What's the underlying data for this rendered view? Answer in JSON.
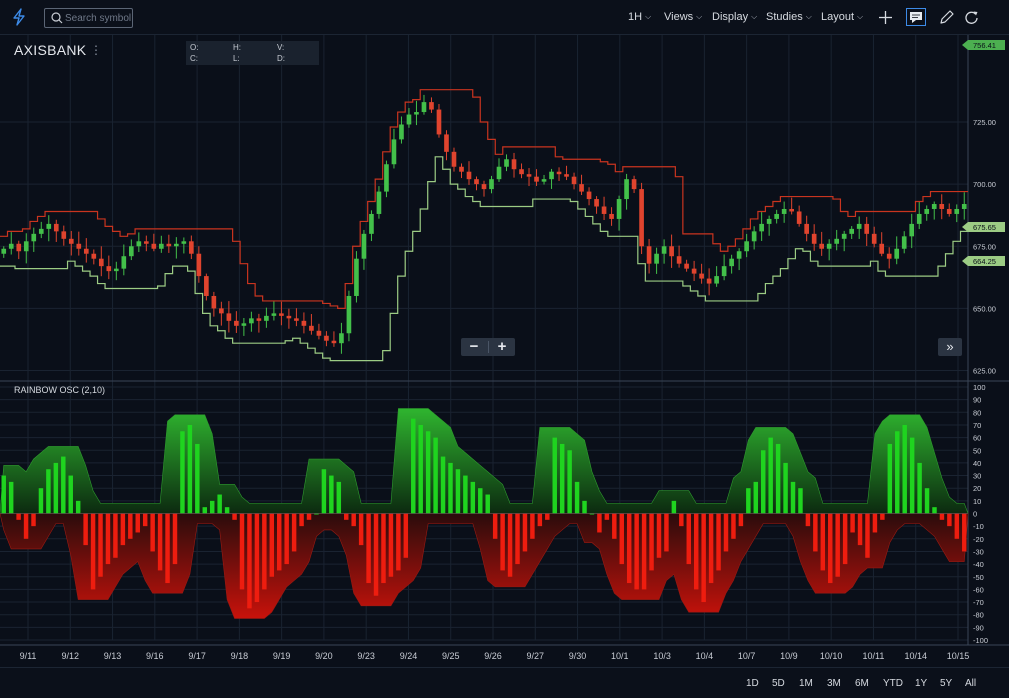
{
  "toolbar": {
    "search_placeholder": "Search symbol",
    "interval": "1H",
    "menus": [
      "Views",
      "Display",
      "Studies",
      "Layout"
    ]
  },
  "symbol": {
    "name": "AXISBANK"
  },
  "ohlc": {
    "o": "O:",
    "h": "H:",
    "v": "V:",
    "c": "C:",
    "l": "L:",
    "d": "D:"
  },
  "indicator": {
    "label": "RAINBOW OSC (2,10)"
  },
  "price_axis": {
    "ticks": [
      "725.00",
      "700.00",
      "675.00",
      "650.00",
      "625.00"
    ],
    "badges": [
      {
        "text": "756.41",
        "color": "#4caf50"
      },
      {
        "text": "675.65",
        "color": "#9ccc84"
      },
      {
        "text": "664.25",
        "color": "#9ccc84"
      }
    ]
  },
  "osc_axis": {
    "ticks": [
      "100",
      "90",
      "80",
      "70",
      "60",
      "50",
      "40",
      "30",
      "20",
      "10",
      "0",
      "-10",
      "-20",
      "-30",
      "-40",
      "-50",
      "-60",
      "-70",
      "-80",
      "-90",
      "-100"
    ]
  },
  "x_axis": {
    "labels": [
      "9/11",
      "9/12",
      "9/13",
      "9/16",
      "9/17",
      "9/18",
      "9/19",
      "9/20",
      "9/23",
      "9/24",
      "9/25",
      "9/26",
      "9/27",
      "9/30",
      "10/1",
      "10/3",
      "10/4",
      "10/7",
      "10/9",
      "10/10",
      "10/11",
      "10/14",
      "10/15"
    ]
  },
  "ranges": [
    "1D",
    "5D",
    "1M",
    "3M",
    "6M",
    "YTD",
    "1Y",
    "5Y",
    "All"
  ],
  "zoom": {
    "minus": "−",
    "plus": "+"
  },
  "ff": "»",
  "colors": {
    "up": "#43c04a",
    "down": "#e0442e",
    "upper_band": "#c9341f",
    "lower_band": "#9ccc84",
    "osc_up": "#1fd41f",
    "osc_down": "#ee1d0f",
    "background": "#0a0f19",
    "grid": "#1a2331"
  },
  "chart_data": {
    "type": "candlestick",
    "price_ylim": [
      622,
      760
    ],
    "close_series": [
      674,
      676,
      673,
      677,
      680,
      682,
      684,
      681,
      678,
      676,
      674,
      672,
      670,
      667,
      665,
      666,
      671,
      675,
      677,
      676,
      674,
      676,
      675,
      676,
      677,
      672,
      663,
      655,
      650,
      648,
      645,
      643,
      644,
      646,
      645,
      647,
      648,
      647,
      646,
      645,
      643,
      641,
      639,
      637,
      636,
      640,
      655,
      670,
      680,
      688,
      697,
      708,
      718,
      724,
      728,
      729,
      733,
      730,
      720,
      713,
      707,
      705,
      702,
      700,
      698,
      702,
      707,
      710,
      706,
      704,
      703,
      701,
      702,
      705,
      704,
      703,
      700,
      697,
      694,
      691,
      688,
      686,
      694,
      702,
      698,
      675,
      668,
      672,
      675,
      671,
      668,
      666,
      664,
      662,
      660,
      663,
      667,
      670,
      673,
      677,
      681,
      684,
      686,
      688,
      690,
      689,
      684,
      680,
      676,
      674,
      676,
      678,
      680,
      682,
      684,
      680,
      676,
      672,
      670,
      674,
      679,
      684,
      688,
      690,
      692,
      690,
      688,
      690,
      692
    ],
    "oscillator": {
      "ylim": [
        -100,
        100
      ],
      "histogram": [
        30,
        25,
        -5,
        -20,
        -10,
        20,
        35,
        40,
        45,
        30,
        10,
        -25,
        -60,
        -50,
        -40,
        -35,
        -25,
        -20,
        -15,
        -10,
        -30,
        -45,
        -55,
        -40,
        65,
        70,
        55,
        5,
        10,
        15,
        5,
        -5,
        -60,
        -75,
        -70,
        -60,
        -50,
        -45,
        -40,
        -30,
        -10,
        -5,
        0,
        35,
        30,
        25,
        -5,
        -10,
        -25,
        -55,
        -65,
        -55,
        -50,
        -45,
        -35,
        75,
        70,
        65,
        60,
        45,
        40,
        35,
        30,
        25,
        20,
        15,
        -20,
        -45,
        -50,
        -40,
        -30,
        -20,
        -10,
        -5,
        60,
        55,
        50,
        25,
        10,
        0,
        -15,
        -5,
        -20,
        -40,
        -55,
        -60,
        -60,
        -45,
        -35,
        -30,
        10,
        -10,
        -40,
        -60,
        -70,
        -55,
        -45,
        -30,
        -20,
        -10,
        20,
        25,
        50,
        60,
        55,
        40,
        25,
        20,
        -10,
        -30,
        -45,
        -55,
        -50,
        -40,
        -15,
        -25,
        -35,
        -15,
        -5,
        55,
        65,
        70,
        60,
        40,
        20,
        5,
        -5,
        -10,
        -20,
        -30
      ]
    }
  }
}
